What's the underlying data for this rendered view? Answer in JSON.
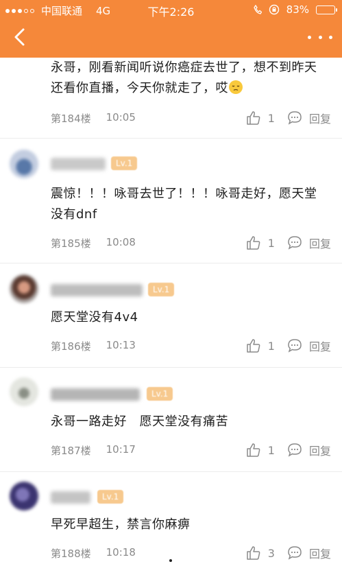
{
  "status_bar": {
    "carrier": "中国联通",
    "network": "4G",
    "time": "下午2:26",
    "battery": "83%",
    "battery_level": 0.83
  },
  "nav": {
    "back_icon": "chevron-left-icon",
    "more_icon": "more-dots-icon"
  },
  "colors": {
    "brand": "#f5883a",
    "level_badge": "#f7c98e",
    "meta_text": "#8a8a8a"
  },
  "comments": [
    {
      "text_line1": "永哥，刚看新闻听说你癌症去世了，想不到昨天",
      "text_line2": "还看你直播，今天你就走了，哎",
      "floor": "第184楼",
      "time": "10:05",
      "likes": "1",
      "reply": "回复"
    },
    {
      "level": "Lv.1",
      "text_line1": "震惊！！！咏哥去世了！！！咏哥走好，愿天堂",
      "text_line2": "没有dnf",
      "floor": "第185楼",
      "time": "10:08",
      "likes": "1",
      "reply": "回复"
    },
    {
      "level": "Lv.1",
      "text_line1": "愿天堂没有4v4",
      "floor": "第186楼",
      "time": "10:13",
      "likes": "1",
      "reply": "回复"
    },
    {
      "level": "Lv.1",
      "text_line1": "永哥一路走好   愿天堂没有痛苦",
      "floor": "第187楼",
      "time": "10:17",
      "likes": "1",
      "reply": "回复"
    },
    {
      "level": "Lv.1",
      "text_line1": "早死早超生，禁言你麻痹",
      "floor": "第188楼",
      "time": "10:18",
      "likes": "3",
      "reply": "回复"
    }
  ]
}
